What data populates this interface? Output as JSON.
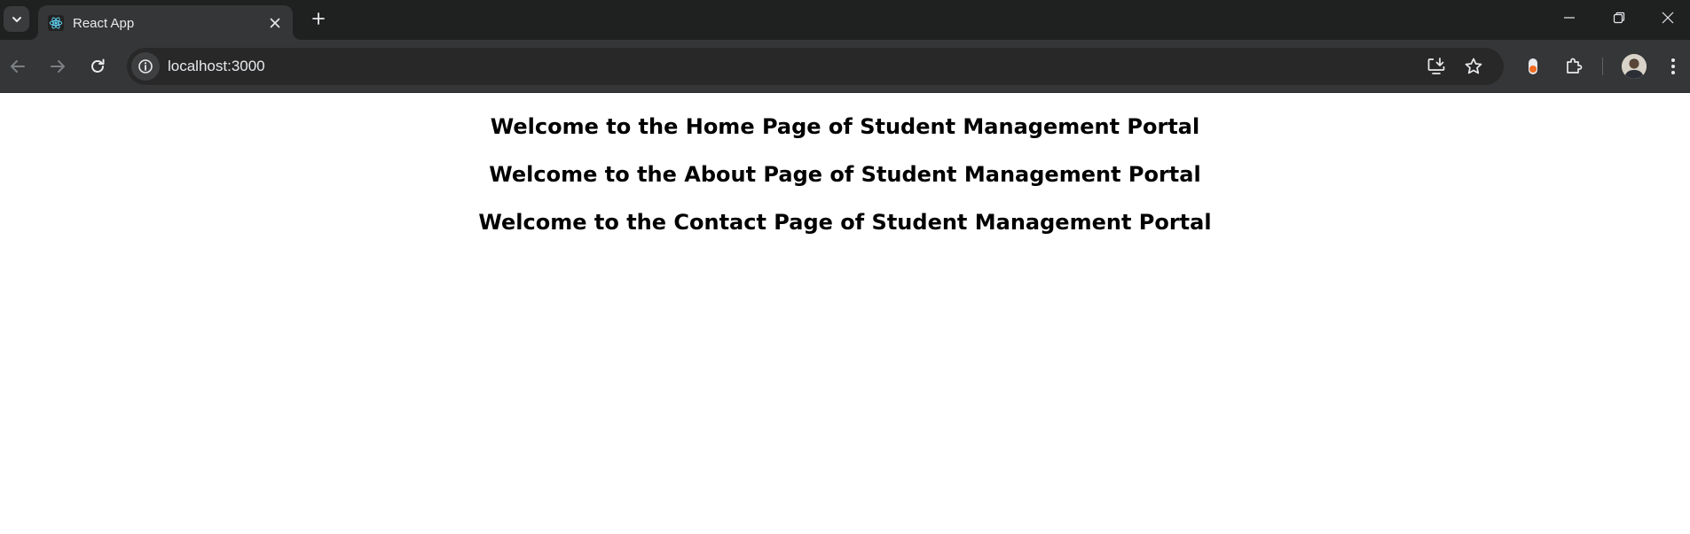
{
  "browser": {
    "tab": {
      "title": "React App"
    },
    "address_bar": {
      "url": "localhost:3000"
    }
  },
  "page": {
    "headings": [
      "Welcome to the Home Page of Student Management Portal",
      "Welcome to the About Page of Student Management Portal",
      "Welcome to the Contact Page of Student Management Portal"
    ]
  }
}
